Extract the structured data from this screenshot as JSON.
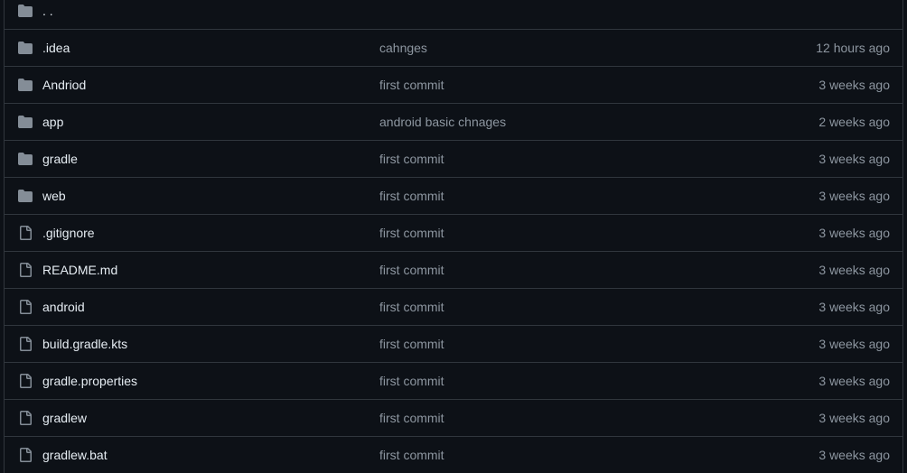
{
  "colors": {
    "background": "#0d1117",
    "border": "#30363d",
    "name_text": "#e6edf3",
    "muted_text": "#8d96a0",
    "icon": "#848d97"
  },
  "parent_row": {
    "name": ". .",
    "icon": "folder-icon"
  },
  "rows": [
    {
      "name": ".idea",
      "icon": "folder-icon",
      "commit": "cahnges",
      "age": "12 hours ago"
    },
    {
      "name": "Andriod",
      "icon": "folder-icon",
      "commit": "first commit",
      "age": "3 weeks ago"
    },
    {
      "name": "app",
      "icon": "folder-icon",
      "commit": "android basic chnages",
      "age": "2 weeks ago"
    },
    {
      "name": "gradle",
      "icon": "folder-icon",
      "commit": "first commit",
      "age": "3 weeks ago"
    },
    {
      "name": "web",
      "icon": "folder-icon",
      "commit": "first commit",
      "age": "3 weeks ago"
    },
    {
      "name": ".gitignore",
      "icon": "file-icon",
      "commit": "first commit",
      "age": "3 weeks ago"
    },
    {
      "name": "README.md",
      "icon": "file-icon",
      "commit": "first commit",
      "age": "3 weeks ago"
    },
    {
      "name": "android",
      "icon": "file-icon",
      "commit": "first commit",
      "age": "3 weeks ago"
    },
    {
      "name": "build.gradle.kts",
      "icon": "file-icon",
      "commit": "first commit",
      "age": "3 weeks ago"
    },
    {
      "name": "gradle.properties",
      "icon": "file-icon",
      "commit": "first commit",
      "age": "3 weeks ago"
    },
    {
      "name": "gradlew",
      "icon": "file-icon",
      "commit": "first commit",
      "age": "3 weeks ago"
    },
    {
      "name": "gradlew.bat",
      "icon": "file-icon",
      "commit": "first commit",
      "age": "3 weeks ago"
    }
  ]
}
